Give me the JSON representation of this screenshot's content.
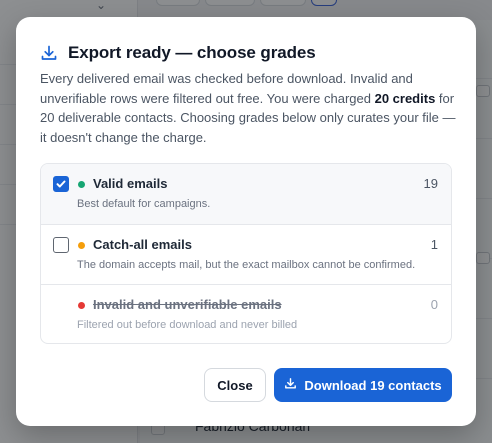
{
  "background": {
    "contact_name": "Fabrizio Carbonari"
  },
  "modal": {
    "title": "Export ready — choose grades",
    "description_before": "Every delivered email was checked before download. Invalid and unverifiable rows were filtered out free. You were charged ",
    "description_bold": "20 credits",
    "description_after": " for 20 deliverable contacts. Choosing grades below only curates your file — it doesn't change the charge.",
    "grades": [
      {
        "label": "Valid emails",
        "description": "Best default for campaigns.",
        "count": "19",
        "checked": true,
        "dot_color": "#17a673"
      },
      {
        "label": "Catch-all emails",
        "description": "The domain accepts mail, but the exact mailbox cannot be confirmed.",
        "count": "1",
        "checked": false,
        "dot_color": "#f59e0b"
      },
      {
        "label": "Invalid and unverifiable emails",
        "description": "Filtered out before download and never billed",
        "count": "0",
        "disabled": true,
        "dot_color": "#e53935"
      }
    ],
    "close_label": "Close",
    "download_label": "Download 19 contacts",
    "accent_color": "#1a64d6"
  }
}
